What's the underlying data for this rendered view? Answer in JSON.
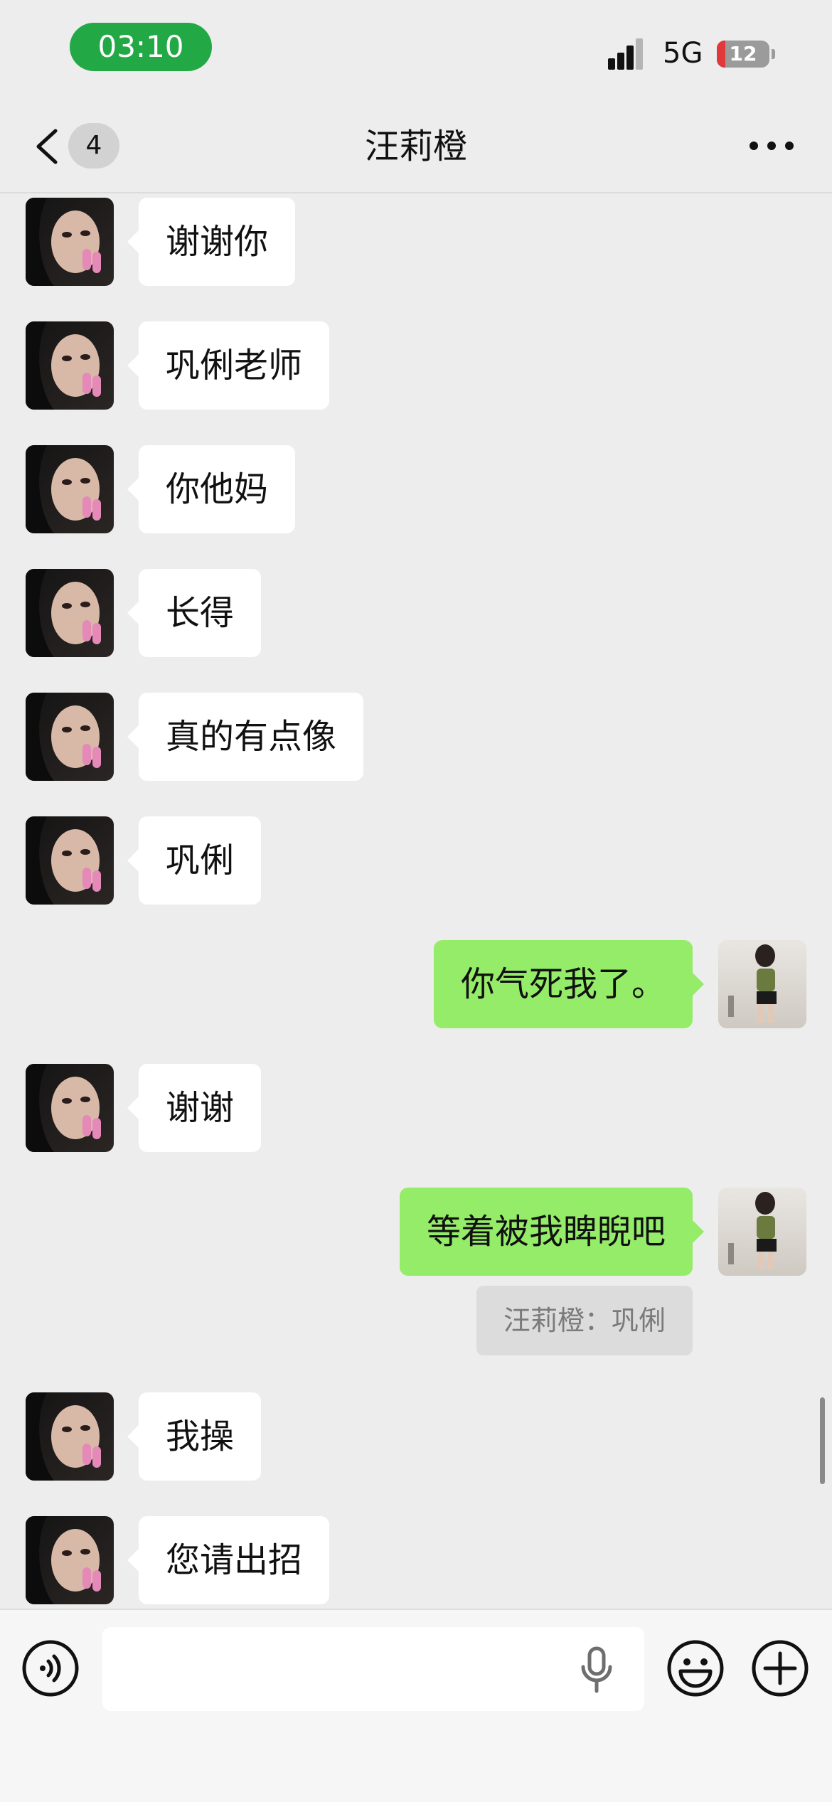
{
  "status_bar": {
    "time": "03:10",
    "network": "5G",
    "battery": "12"
  },
  "nav": {
    "unread_count": "4",
    "title": "汪莉橙"
  },
  "messages": [
    {
      "side": "in",
      "text": "谢谢你"
    },
    {
      "side": "in",
      "text": "巩俐老师"
    },
    {
      "side": "in",
      "text": "你他妈"
    },
    {
      "side": "in",
      "text": "长得"
    },
    {
      "side": "in",
      "text": "真的有点像"
    },
    {
      "side": "in",
      "text": "巩俐"
    },
    {
      "side": "out",
      "text": "你气死我了。"
    },
    {
      "side": "in",
      "text": "谢谢"
    },
    {
      "side": "out",
      "text": "等着被我睥睨吧",
      "quote": "汪莉橙：巩俐"
    },
    {
      "side": "in",
      "text": "我操"
    },
    {
      "side": "in",
      "text": "您请出招"
    }
  ],
  "input": {
    "placeholder": ""
  },
  "colors": {
    "outgoing_bubble": "#95ec69",
    "incoming_bubble": "#ffffff",
    "background": "#ededed",
    "clock_pill": "#22a845"
  }
}
